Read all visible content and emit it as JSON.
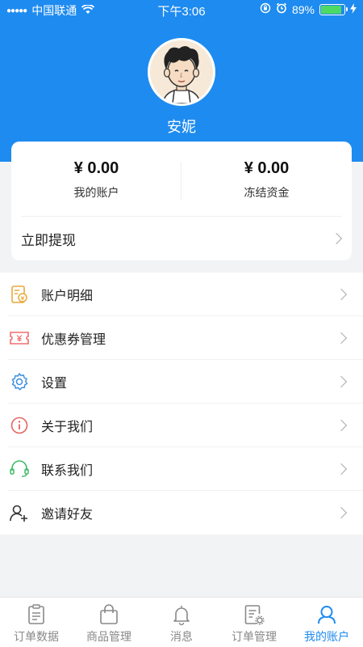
{
  "status_bar": {
    "carrier": "中国联通",
    "time": "下午3:06",
    "battery_percent": "89%",
    "battery_level": 0.89
  },
  "profile": {
    "username": "安妮"
  },
  "balances": {
    "account": {
      "amount": "¥ 0.00",
      "label": "我的账户"
    },
    "frozen": {
      "amount": "¥ 0.00",
      "label": "冻结资金"
    },
    "withdraw_label": "立即提现"
  },
  "menu": {
    "items": [
      {
        "label": "账户明细",
        "icon": "ledger-icon"
      },
      {
        "label": "优惠券管理",
        "icon": "coupon-icon"
      },
      {
        "label": "设置",
        "icon": "gear-icon"
      },
      {
        "label": "关于我们",
        "icon": "info-icon"
      },
      {
        "label": "联系我们",
        "icon": "headset-icon"
      },
      {
        "label": "邀请好友",
        "icon": "add-user-icon"
      }
    ]
  },
  "tabbar": {
    "tabs": [
      {
        "label": "订单数据",
        "icon": "clipboard-icon",
        "active": false
      },
      {
        "label": "商品管理",
        "icon": "shopping-bag-icon",
        "active": false
      },
      {
        "label": "消息",
        "icon": "bell-icon",
        "active": false
      },
      {
        "label": "订单管理",
        "icon": "order-settings-icon",
        "active": false
      },
      {
        "label": "我的账户",
        "icon": "user-icon",
        "active": true
      }
    ]
  },
  "colors": {
    "primary": "#1e8bf0",
    "ledger_icon": "#e8a93a",
    "coupon_icon": "#ef6e6e",
    "gear_icon": "#3c8ee0",
    "info_icon": "#e5655f",
    "headset_icon": "#3dbb6a",
    "tab_inactive": "#888888"
  }
}
